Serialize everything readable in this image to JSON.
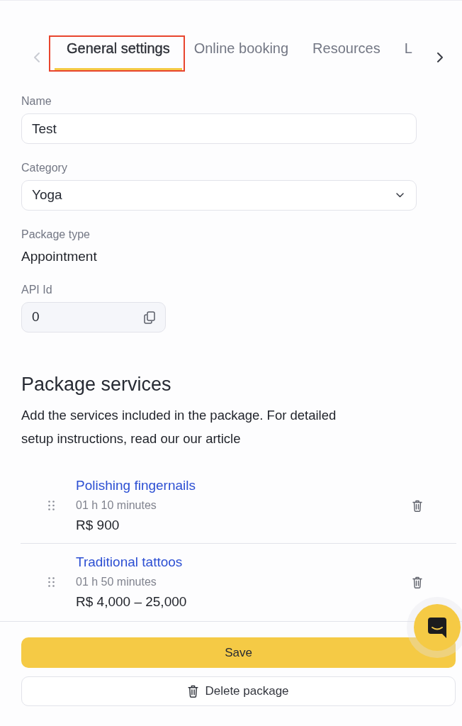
{
  "tabs": {
    "scroll_left": {
      "disabled": true
    },
    "scroll_right": {
      "disabled": false
    },
    "items": [
      {
        "label": "General settings",
        "selected": true,
        "highlighted": true
      },
      {
        "label": "Online booking",
        "selected": false,
        "highlighted": false
      },
      {
        "label": "Resources",
        "selected": false,
        "highlighted": false
      },
      {
        "label": "L",
        "selected": false,
        "highlighted": false
      }
    ]
  },
  "form": {
    "fields": [
      {
        "kind": "input",
        "label": "Name",
        "value": "Test"
      },
      {
        "kind": "select",
        "label": "Category",
        "value": "Yoga"
      },
      {
        "kind": "static",
        "label": "Package type",
        "value": "Appointment"
      },
      {
        "kind": "copy",
        "label": "API Id",
        "value": "0"
      }
    ]
  },
  "package_services": {
    "title": "Package services",
    "description": "Add the services included in the package. For detailed setup instructions, read our our article",
    "services": [
      {
        "name": "Polishing fingernails",
        "duration": "01 h 10 minutes",
        "price": "R$ 900"
      },
      {
        "name": "Traditional tattoos",
        "duration": "01 h 50 minutes",
        "price": "R$ 4,000 – 25,000"
      }
    ]
  },
  "footer": {
    "save_label": "Save",
    "delete_label": "Delete package"
  }
}
